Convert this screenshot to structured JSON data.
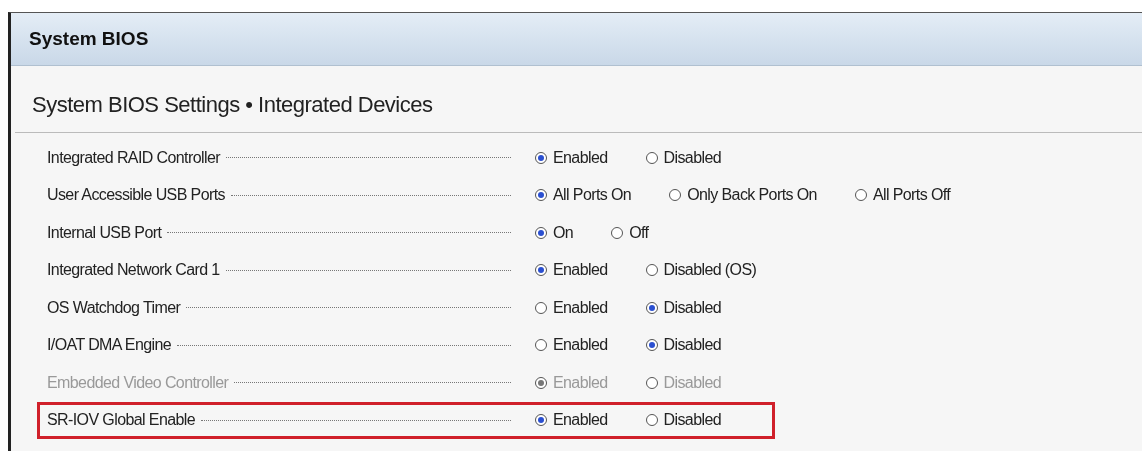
{
  "window": {
    "title": "System BIOS"
  },
  "section": {
    "title": "System BIOS Settings • Integrated Devices"
  },
  "settings": [
    {
      "label": "Integrated RAID Controller",
      "disabled": false,
      "highlighted": false,
      "options": [
        {
          "label": "Enabled",
          "selected": true
        },
        {
          "label": "Disabled",
          "selected": false
        }
      ]
    },
    {
      "label": "User Accessible USB Ports",
      "disabled": false,
      "highlighted": false,
      "options": [
        {
          "label": "All Ports On",
          "selected": true
        },
        {
          "label": "Only Back Ports On",
          "selected": false
        },
        {
          "label": "All Ports Off",
          "selected": false
        }
      ]
    },
    {
      "label": "Internal USB Port",
      "disabled": false,
      "highlighted": false,
      "options": [
        {
          "label": "On",
          "selected": true
        },
        {
          "label": "Off",
          "selected": false
        }
      ]
    },
    {
      "label": "Integrated Network Card 1",
      "disabled": false,
      "highlighted": false,
      "options": [
        {
          "label": "Enabled",
          "selected": true
        },
        {
          "label": "Disabled (OS)",
          "selected": false
        }
      ]
    },
    {
      "label": "OS Watchdog Timer",
      "disabled": false,
      "highlighted": false,
      "options": [
        {
          "label": "Enabled",
          "selected": false
        },
        {
          "label": "Disabled",
          "selected": true
        }
      ]
    },
    {
      "label": "I/OAT DMA Engine",
      "disabled": false,
      "highlighted": false,
      "options": [
        {
          "label": "Enabled",
          "selected": false
        },
        {
          "label": "Disabled",
          "selected": true
        }
      ]
    },
    {
      "label": "Embedded Video Controller",
      "disabled": true,
      "highlighted": false,
      "options": [
        {
          "label": "Enabled",
          "selected": true
        },
        {
          "label": "Disabled",
          "selected": false
        }
      ]
    },
    {
      "label": "SR-IOV Global Enable",
      "disabled": false,
      "highlighted": true,
      "options": [
        {
          "label": "Enabled",
          "selected": true
        },
        {
          "label": "Disabled",
          "selected": false
        }
      ]
    }
  ]
}
